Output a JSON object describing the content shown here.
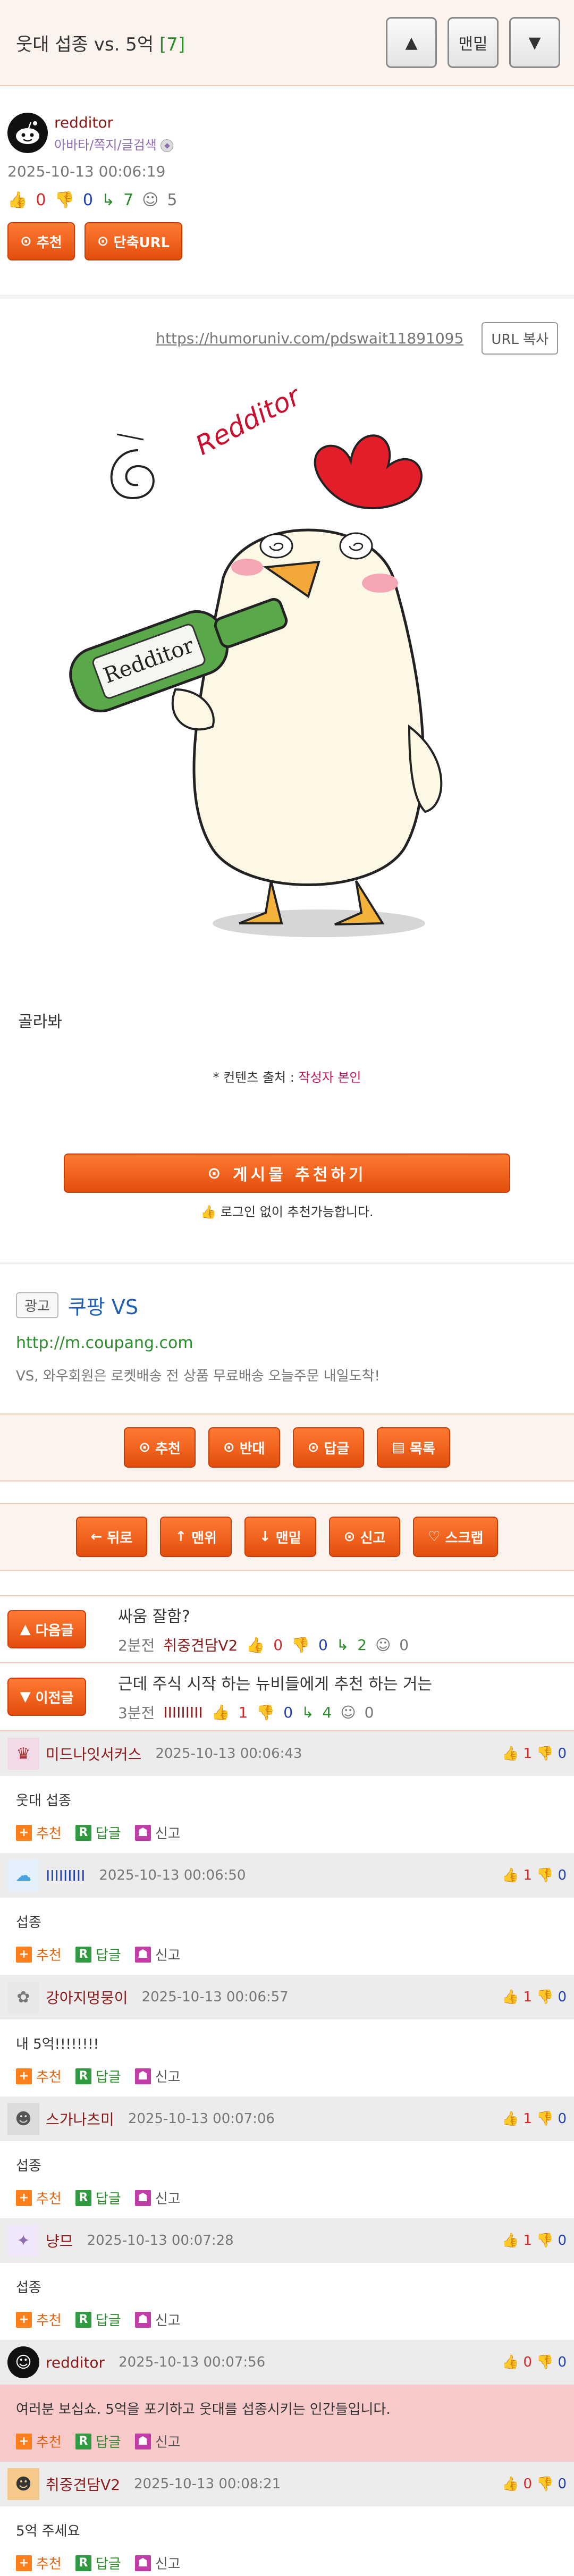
{
  "header": {
    "title": "웃대 섭종 vs. 5억",
    "comment_count": "[7]",
    "up_label": "▲",
    "top_label": "맨밑",
    "down_label": "▼"
  },
  "post": {
    "author": "redditor",
    "author_links": "아바타/쪽지/글검색",
    "date": "2025-10-13 00:06:19",
    "stats": {
      "up": "0",
      "down": "0",
      "views": "7",
      "comments": "5"
    },
    "recommend_label": "추천",
    "short_url_label": "단축URL",
    "url": "https://humoruniv.com/pdswait11891095",
    "url_copy_label": "URL 복사",
    "illustration_labels": [
      "Redditor",
      "Redditor"
    ],
    "caption": "골라봐",
    "source_prefix": "* 컨텐츠 출처 :",
    "source_value": "작성자 본인",
    "big_recommend_label": "게시물 추천하기",
    "login_recommend_note": "로그인 없이 추천가능합니다."
  },
  "ad": {
    "tag": "광고",
    "title": "쿠팡 VS",
    "url": "http://m.coupang.com",
    "desc": "VS, 와우회원은 로켓배송 전 상품 무료배송 오늘주문 내일도착!"
  },
  "actions1": [
    "추천",
    "반대",
    "답글",
    "목록"
  ],
  "actions2": [
    "뒤로",
    "맨위",
    "맨밑",
    "신고",
    "스크랩"
  ],
  "nav": [
    {
      "btn": "다음글",
      "title": "싸움 잘함?",
      "cat": "2분전",
      "nick": "취중견담V2",
      "up": "0",
      "down": "0",
      "views": "2",
      "comments": "0"
    },
    {
      "btn": "이전글",
      "title": "근데 주식 시작 하는 뉴비들에게 추천 하는 거는",
      "cat": "3분전",
      "nick": "IIIIIIIII",
      "up": "1",
      "down": "0",
      "views": "4",
      "comments": "0"
    }
  ],
  "comment_actions": {
    "recommend": "추천",
    "reply": "답글",
    "report": "신고"
  },
  "comments": [
    {
      "nick": "미드나잇서커스",
      "date": "2025-10-13 00:06:43",
      "up": "1",
      "down": "0",
      "body": "웃대 섭종"
    },
    {
      "nick": "IIIIIIIII",
      "date": "2025-10-13 00:06:50",
      "up": "1",
      "down": "0",
      "body": "섭종"
    },
    {
      "nick": "강아지멍뭉이",
      "date": "2025-10-13 00:06:57",
      "up": "1",
      "down": "0",
      "body": "내 5억!!!!!!!!"
    },
    {
      "nick": "스가나츠미",
      "date": "2025-10-13 00:07:06",
      "up": "1",
      "down": "0",
      "body": "섭종"
    },
    {
      "nick": "냥므",
      "date": "2025-10-13 00:07:28",
      "up": "1",
      "down": "0",
      "body": "섭종"
    },
    {
      "nick": "redditor",
      "date": "2025-10-13 00:07:56",
      "up": "0",
      "down": "0",
      "body": "여러분 보십쇼. 5억을 포기하고 웃대를 섭종시키는 인간들입니다."
    },
    {
      "nick": "취중견담V2",
      "date": "2025-10-13 00:08:21",
      "up": "0",
      "down": "0",
      "body": "5억 주세요"
    }
  ]
}
